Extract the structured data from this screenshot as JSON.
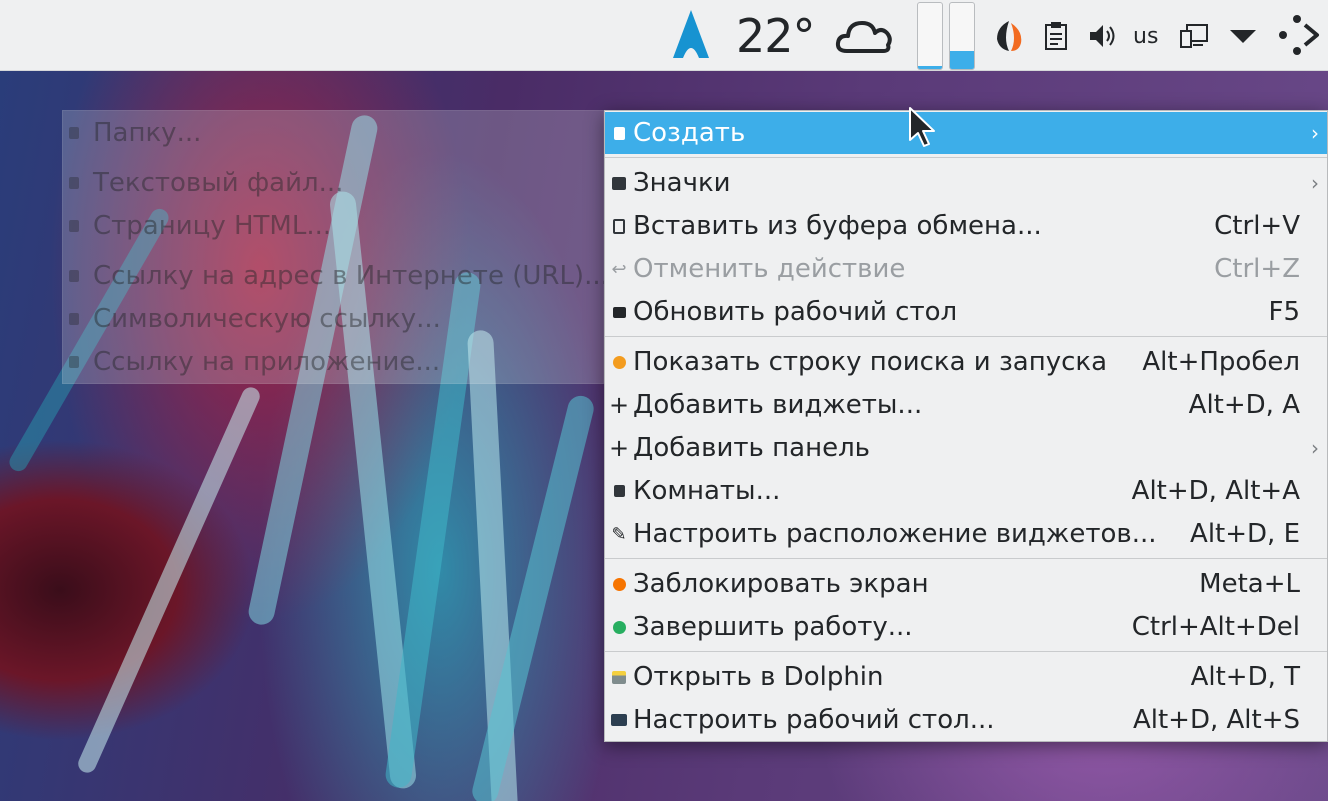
{
  "panel": {
    "temperature": "22°",
    "keyboard_layout": "us",
    "gauge_levels": [
      0.05,
      0.28
    ]
  },
  "submenu": {
    "items": [
      {
        "label": "Папку..."
      },
      {
        "label": "Текстовый файл..."
      },
      {
        "label": "Страницу HTML..."
      },
      {
        "label": "Ссылку на адрес в Интернете (URL)..."
      },
      {
        "label": "Символическую ссылку..."
      },
      {
        "label": "Ссылку на приложение..."
      }
    ]
  },
  "menu": {
    "items": [
      {
        "label": "Создать",
        "shortcut": "",
        "icon": "new-document-icon"
      },
      {
        "label": "Значки",
        "shortcut": "",
        "icon": "icons-view-icon"
      },
      {
        "label": "Вставить из буфера обмена...",
        "shortcut": "Ctrl+V",
        "icon": "clipboard-icon"
      },
      {
        "label": "Отменить действие",
        "shortcut": "Ctrl+Z",
        "icon": "undo-icon"
      },
      {
        "label": "Обновить рабочий стол",
        "shortcut": "F5",
        "icon": "refresh-icon"
      },
      {
        "label": "Показать строку поиска и запуска",
        "shortcut": "Alt+Пробел",
        "icon": "krunner-icon"
      },
      {
        "label": "Добавить виджеты...",
        "shortcut": "Alt+D, A",
        "icon": "plus-icon"
      },
      {
        "label": "Добавить панель",
        "shortcut": "",
        "icon": "plus-icon"
      },
      {
        "label": "Комнаты...",
        "shortcut": "Alt+D, Alt+A",
        "icon": "activities-icon"
      },
      {
        "label": "Настроить расположение виджетов...",
        "shortcut": "Alt+D, E",
        "icon": "pencil-icon"
      },
      {
        "label": "Заблокировать экран",
        "shortcut": "Meta+L",
        "icon": "lock-icon"
      },
      {
        "label": "Завершить работу...",
        "shortcut": "Ctrl+Alt+Del",
        "icon": "logout-icon"
      },
      {
        "label": "Открыть в Dolphin",
        "shortcut": "Alt+D, T",
        "icon": "dolphin-icon"
      },
      {
        "label": "Настроить рабочий стол...",
        "shortcut": "Alt+D, Alt+S",
        "icon": "desktop-settings-icon"
      }
    ]
  },
  "colors": {
    "highlight": "#3daee9",
    "menu_bg": "#eff0f1",
    "text": "#232629",
    "disabled_text": "#9a9ea2",
    "lock_orange": "#f67400",
    "logout_green": "#27ae60"
  }
}
